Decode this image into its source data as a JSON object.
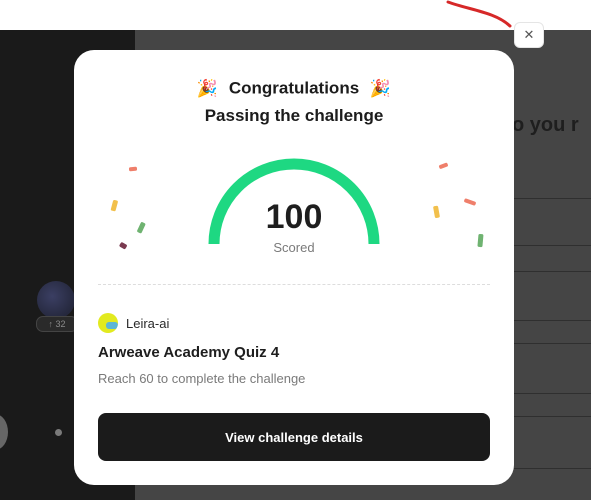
{
  "background": {
    "right_question_fragment": "o you r",
    "side_badge": "↑ 32"
  },
  "modal": {
    "close_glyph": "✕",
    "party_emoji": "🎉",
    "title": "Congratulations",
    "subtitle": "Passing the challenge",
    "score": "100",
    "score_label": "Scored",
    "gauge_fraction": 1.0,
    "org_name": "Leira-ai",
    "quiz_title": "Arweave Academy Quiz 4",
    "quiz_desc": "Reach 60 to complete the challenge",
    "cta_label": "View challenge details"
  },
  "colors": {
    "gauge": "#1ed882",
    "annotation_arrow": "#d62828"
  },
  "icons": [
    "party-popper-icon",
    "close-icon",
    "org-avatar-icon"
  ]
}
